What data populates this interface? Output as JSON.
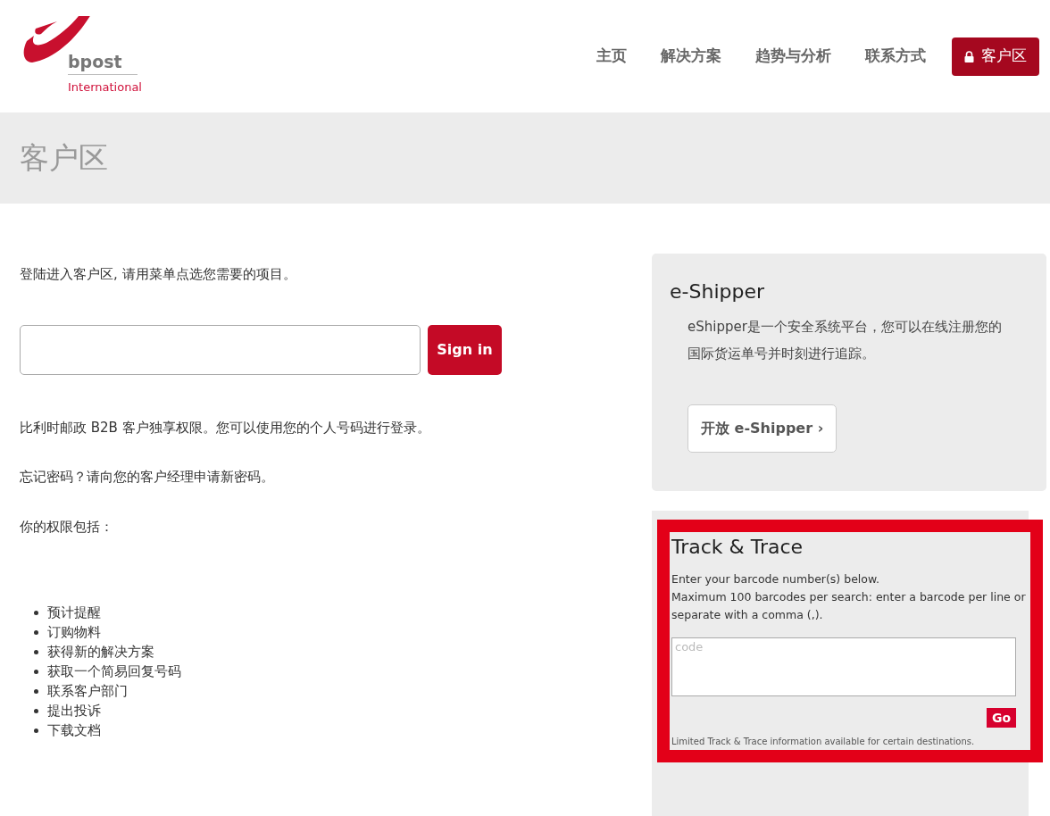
{
  "logo": {
    "name": "bpost",
    "subtitle": "International"
  },
  "nav": [
    {
      "label": "主页",
      "selected": false
    },
    {
      "label": "解决方案",
      "selected": false
    },
    {
      "label": "趋势与分析",
      "selected": false
    },
    {
      "label": "联系方式",
      "selected": false
    },
    {
      "label": "客户区",
      "selected": true
    }
  ],
  "page_title": "客户区",
  "intro": "登陆进入客户区, 请用菜单点选您需要的项目。",
  "login": {
    "button": "Sign in"
  },
  "paragraphs": [
    "比利时邮政 B2B 客户独享权限。您可以使用您的个人号码进行登录。",
    "忘记密码？请向您的客户经理申请新密码。",
    "你的权限包括："
  ],
  "privileges": [
    "预计提醒",
    "订购物料",
    "获得新的解决方案",
    "获取一个简易回复号码",
    "联系客户部门",
    "提出投诉",
    "下载文档"
  ],
  "eshipper": {
    "title": "e-Shipper",
    "text": "eShipper是一个安全系统平台，您可以在线注册您的国际货运单号并时刻进行追踪。",
    "button": "开放 e-Shipper ›"
  },
  "track": {
    "title": "Track & Trace",
    "line1": "Enter your barcode number(s) below.",
    "line2": "Maximum 100 barcodes per search: enter a barcode per line or separate with a comma (,).",
    "placeholder": "code",
    "button": "Go",
    "note": "Limited Track & Trace information available for certain destinations."
  }
}
